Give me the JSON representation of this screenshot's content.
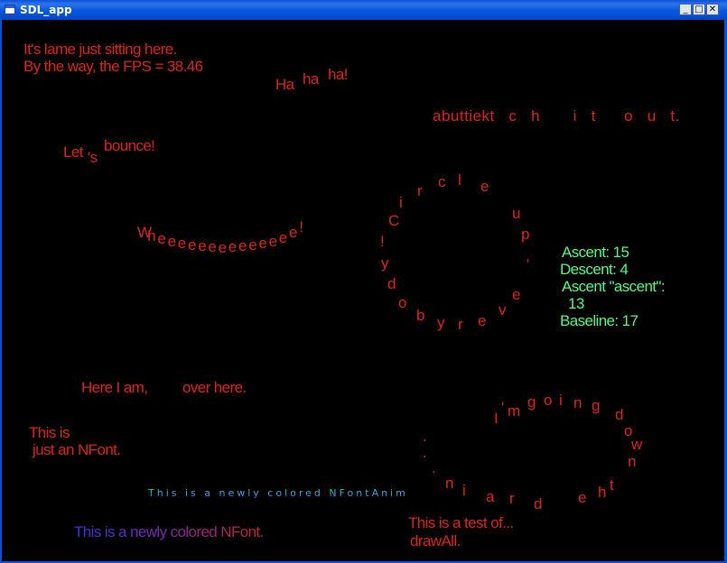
{
  "window": {
    "title": "SDL_app",
    "minimize_glyph": "_",
    "maximize_glyph": "□",
    "close_glyph": "✕"
  },
  "colors": {
    "text_red": "#d8281e",
    "text_green": "#5af78a",
    "title_bar": "#0a4fd6"
  },
  "scene": {
    "idle_line1": "It's lame just sitting here.",
    "idle_line2": "By the way, the FPS = 38.46",
    "haha": [
      "Ha",
      "ha",
      "ha!"
    ],
    "scroll_text": "abuttiekt   c   h       i   t      o   u   t.",
    "bounce": [
      "Let",
      "'s",
      "bounce!"
    ],
    "whee": "Wheeeeeeeeeeeeee!",
    "circle_chars": [
      "C",
      "i",
      "r",
      "c",
      "l",
      "e",
      "u",
      "p",
      ",",
      "e",
      "v",
      "e",
      "r",
      "y",
      "b",
      "o",
      "d",
      "y",
      "!"
    ],
    "metrics": {
      "ascent": "Ascent: 15",
      "descent": "Descent: 4",
      "ascent_string": "Ascent \"ascent\":",
      "ascent_string_value": "13",
      "baseline": "Baseline: 17"
    },
    "here": "Here I am,",
    "over": "over here.",
    "nfont_line1": "This is",
    "nfont_line2": "just an NFont.",
    "anim_text": "This is a newly colored NFontAnim",
    "colored_nfont": "This is a newly colored NFont.",
    "going_chars": [
      "I",
      "'",
      "m",
      "g",
      "o",
      "i",
      "n",
      "g",
      "d",
      "o",
      "w",
      "n",
      "t",
      "h",
      "e",
      "d",
      "r",
      "a",
      "i",
      "n",
      ".",
      ".",
      "."
    ],
    "drawall_line1": "This is a test of...",
    "drawall_line2": "drawAll."
  }
}
